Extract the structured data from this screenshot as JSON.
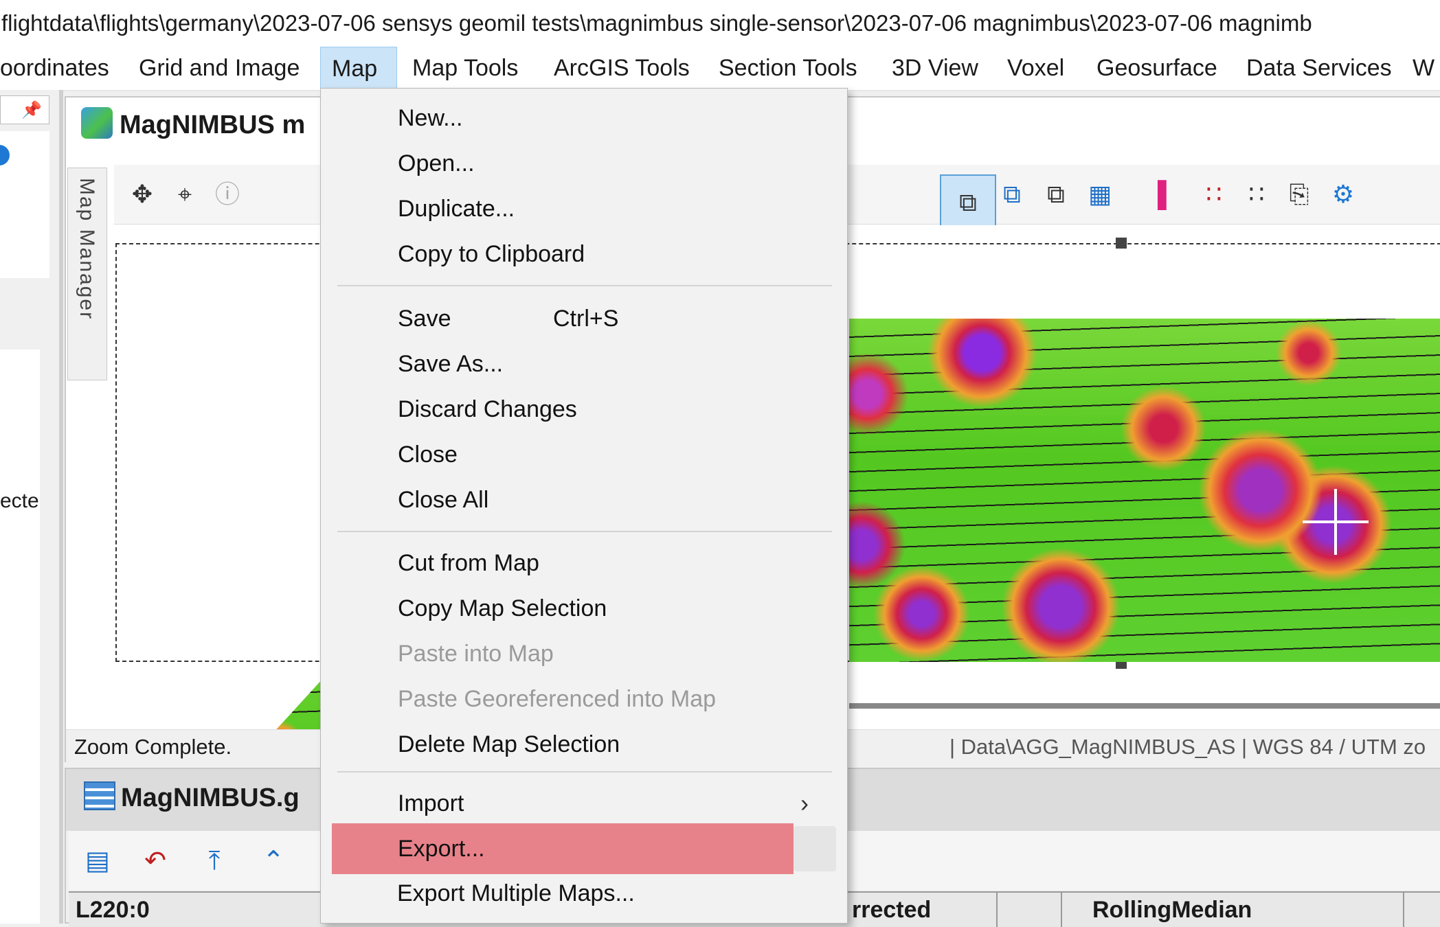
{
  "window": {
    "title_path": "flightdata\\flights\\germany\\2023-07-06 sensys geomil tests\\magnimbus single-sensor\\2023-07-06 magnimbus\\2023-07-06 magnimb"
  },
  "menubar": {
    "items": [
      {
        "label": "oordinates"
      },
      {
        "label": "Grid and Image"
      },
      {
        "label": "Map"
      },
      {
        "label": "Map Tools"
      },
      {
        "label": "ArcGIS Tools"
      },
      {
        "label": "Section Tools"
      },
      {
        "label": "3D View"
      },
      {
        "label": "Voxel"
      },
      {
        "label": "Geosurface"
      },
      {
        "label": "Data Services"
      },
      {
        "label": "W"
      }
    ],
    "active": "Map"
  },
  "leftdock": {
    "partial_text": "ecte"
  },
  "map_window": {
    "title": "MagNIMBUS m",
    "side_tab": "Map Manager",
    "status_left": "Zoom Complete.",
    "status_right": "| Data\\AGG_MagNIMBUS_AS | WGS 84 / UTM zo"
  },
  "db_window": {
    "title": "MagNIMBUS.g",
    "columns": [
      "L220:0",
      "rrected",
      "RollingMedian"
    ]
  },
  "map_menu": {
    "items": [
      {
        "label": "New...",
        "enabled": true
      },
      {
        "label": "Open...",
        "enabled": true
      },
      {
        "label": "Duplicate...",
        "enabled": true
      },
      {
        "label": "Copy to Clipboard",
        "enabled": true
      },
      {
        "label": "Save",
        "shortcut": "Ctrl+S",
        "enabled": true
      },
      {
        "label": "Save As...",
        "enabled": true
      },
      {
        "label": "Discard Changes",
        "enabled": true
      },
      {
        "label": "Close",
        "enabled": true
      },
      {
        "label": "Close All",
        "enabled": true
      },
      {
        "label": "Cut from Map",
        "enabled": true
      },
      {
        "label": "Copy Map Selection",
        "enabled": true
      },
      {
        "label": "Paste into Map",
        "enabled": false
      },
      {
        "label": "Paste Georeferenced into Map",
        "enabled": false
      },
      {
        "label": "Delete Map Selection",
        "enabled": true
      },
      {
        "label": "Import",
        "enabled": true,
        "submenu": true
      },
      {
        "label": "Export...",
        "enabled": true,
        "highlighted": true
      },
      {
        "label": "Export Multiple Maps...",
        "enabled": true
      }
    ],
    "highlight_color": "#e8828a"
  },
  "colors": {
    "menu_active_bg": "#cce4f7",
    "accent": "#1e78d4"
  },
  "icons": {
    "pin": "pin-icon",
    "arrow": "chevron-right-icon"
  }
}
